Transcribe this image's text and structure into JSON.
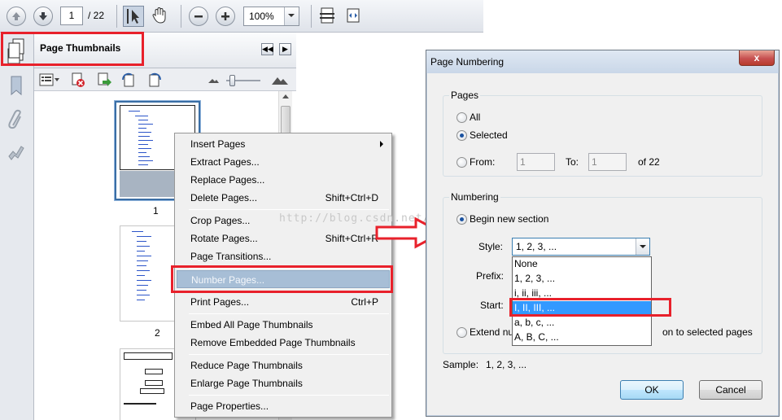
{
  "toolbar": {
    "page_current": "1",
    "page_total": "/ 22",
    "zoom": "100%",
    "icons": [
      "prev-page-icon",
      "next-page-icon",
      "select-tool-icon",
      "hand-tool-icon",
      "zoom-out-icon",
      "zoom-in-icon",
      "fit-page-icon",
      "fit-width-icon"
    ]
  },
  "panel": {
    "title": "Page Thumbnails",
    "thumbnails": [
      {
        "label": "1",
        "selected": true
      },
      {
        "label": "2",
        "selected": false
      },
      {
        "label": "",
        "selected": false
      }
    ]
  },
  "context_menu": {
    "items": [
      {
        "label": "Insert Pages",
        "shortcut": "",
        "submenu": true
      },
      {
        "label": "Extract Pages...",
        "shortcut": ""
      },
      {
        "label": "Replace Pages...",
        "shortcut": ""
      },
      {
        "label": "Delete Pages...",
        "shortcut": "Shift+Ctrl+D"
      },
      {
        "label": "Crop Pages...",
        "shortcut": ""
      },
      {
        "label": "Rotate Pages...",
        "shortcut": "Shift+Ctrl+R"
      },
      {
        "label": "Page Transitions...",
        "shortcut": ""
      },
      {
        "label": "Number Pages...",
        "shortcut": "",
        "highlighted": true
      },
      {
        "label": "Print Pages...",
        "shortcut": "Ctrl+P"
      },
      {
        "label": "Embed All Page Thumbnails",
        "shortcut": ""
      },
      {
        "label": "Remove Embedded Page Thumbnails",
        "shortcut": ""
      },
      {
        "label": "Reduce Page Thumbnails",
        "shortcut": ""
      },
      {
        "label": "Enlarge Page Thumbnails",
        "shortcut": ""
      },
      {
        "label": "Page Properties...",
        "shortcut": ""
      }
    ]
  },
  "watermark": "http://blog.csdn.net/",
  "dialog": {
    "title": "Page Numbering",
    "close": "x",
    "pages_group": "Pages",
    "opt_all": "All",
    "opt_selected": "Selected",
    "opt_from": "From:",
    "from_value": "1",
    "to_label": "To:",
    "to_value": "1",
    "of_total": "of 22",
    "numbering_group": "Numbering",
    "begin_new_section": "Begin new section",
    "style_label": "Style:",
    "style_value": "1, 2, 3, ...",
    "prefix_label": "Prefix:",
    "start_label": "Start:",
    "extend_left": "Extend nu",
    "extend_right": "on to selected pages",
    "style_options": [
      "None",
      "1, 2, 3, ...",
      "i, ii, iii, ...",
      "I, II, III, ...",
      "a, b, c, ...",
      "A, B, C, ..."
    ],
    "style_highlighted": "I, II, III, ...",
    "sample_label": "Sample:",
    "sample_value": "1, 2, 3, ...",
    "ok": "OK",
    "cancel": "Cancel"
  },
  "colors": {
    "annotation_red": "#e8212b",
    "menu_highlight": "#a7bed6",
    "list_selection": "#3399ff"
  }
}
